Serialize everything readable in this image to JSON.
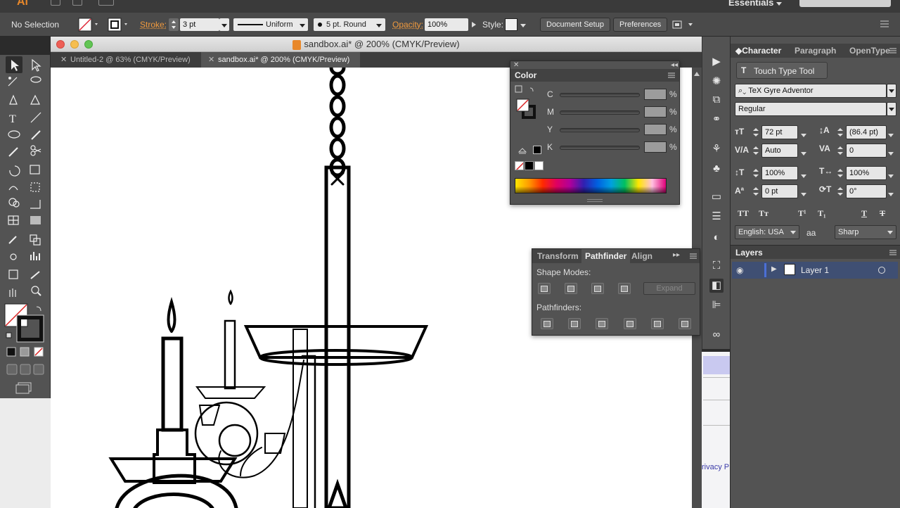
{
  "app": {
    "logo": "Ai",
    "workspace": "Essentials"
  },
  "control_bar": {
    "selection_status": "No Selection",
    "stroke_label": "Stroke:",
    "stroke_weight": "3 pt",
    "variable_width_profile": "Uniform",
    "brush": "5 pt. Round",
    "opacity_label": "Opacity:",
    "opacity_value": "100%",
    "style_label": "Style:",
    "document_setup_button": "Document Setup",
    "preferences_button": "Preferences"
  },
  "document_window": {
    "title": "sandbox.ai* @ 200% (CMYK/Preview)",
    "tabs": [
      {
        "label": "Untitled-2 @ 63% (CMYK/Preview)",
        "active": false
      },
      {
        "label": "sandbox.ai* @ 200% (CMYK/Preview)",
        "active": true
      }
    ]
  },
  "color_panel": {
    "title": "Color",
    "channels": [
      {
        "name": "C",
        "unit": "%"
      },
      {
        "name": "M",
        "unit": "%"
      },
      {
        "name": "Y",
        "unit": "%"
      },
      {
        "name": "K",
        "unit": "%"
      }
    ]
  },
  "pathfinder_panel": {
    "tabs": [
      "Transform",
      "Pathfinder",
      "Align"
    ],
    "active_tab": "Pathfinder",
    "shape_modes_label": "Shape Modes:",
    "expand_button": "Expand",
    "pathfinders_label": "Pathfinders:"
  },
  "character_panel": {
    "tabs": [
      "Character",
      "Paragraph",
      "OpenType"
    ],
    "touch_type_tool": "Touch Type Tool",
    "font_family": "TeX Gyre Adventor",
    "font_style": "Regular",
    "font_size": "72 pt",
    "leading": "(86.4 pt)",
    "kerning": "Auto",
    "tracking": "0",
    "vertical_scale": "100%",
    "horizontal_scale": "100%",
    "baseline_shift": "0 pt",
    "character_rotation": "0°",
    "language": "English: USA",
    "anti_aliasing": "Sharp",
    "aa_icon": "aa"
  },
  "layers_panel": {
    "title": "Layers",
    "layers": [
      {
        "name": "Layer 1",
        "visible": true
      }
    ]
  },
  "background_page": {
    "link_text": "rivacy P"
  },
  "colors": {
    "accent_orange": "#f09a3e",
    "layer_highlight": "#4b6fd6"
  }
}
